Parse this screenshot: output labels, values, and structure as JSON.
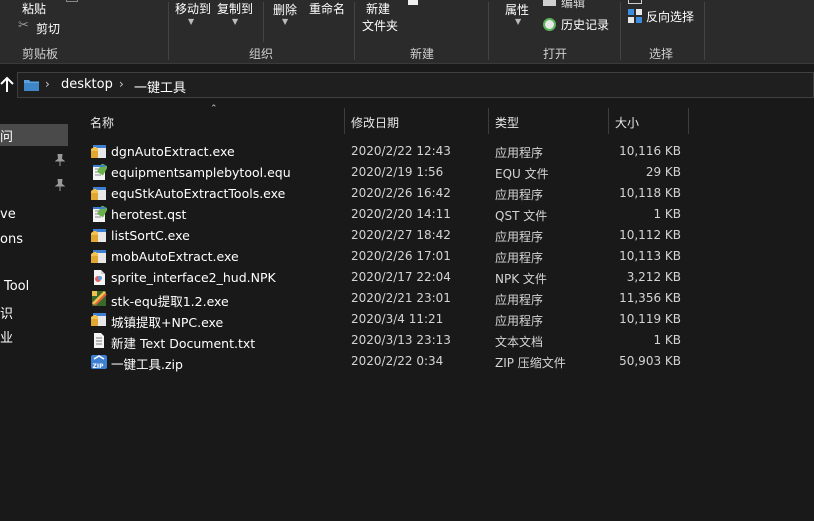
{
  "ribbon": {
    "paste": "粘贴",
    "cut": "剪切",
    "clipboard_group": "剪贴板",
    "move_to": "移动到",
    "copy_to": "复制到",
    "delete": "删除",
    "rename": "重命名",
    "organize_group": "组织",
    "new_folder_line1": "新建",
    "new_folder_line2": "文件夹",
    "new_group": "新建",
    "properties": "属性",
    "edit": "编辑",
    "history": "历史记录",
    "open_group": "打开",
    "invert_select": "反向选择",
    "select_group": "选择"
  },
  "address": {
    "segments": [
      "desktop",
      "一键工具"
    ]
  },
  "nav": {
    "items": [
      "问",
      "ve",
      "ons",
      "Tool",
      "识",
      "业"
    ]
  },
  "columns": {
    "name": "名称",
    "modified": "修改日期",
    "type": "类型",
    "size": "大小"
  },
  "files": [
    {
      "name": "dgnAutoExtract.exe",
      "modified": "2020/2/22 12:43",
      "type": "应用程序",
      "size": "10,116 KB",
      "icon": "exe-icon"
    },
    {
      "name": "equipmentsamplebytool.equ",
      "modified": "2020/2/19 1:56",
      "type": "EQU 文件",
      "size": "29 KB",
      "icon": "notepad-file-icon"
    },
    {
      "name": "equStkAutoExtractTools.exe",
      "modified": "2020/2/26 16:42",
      "type": "应用程序",
      "size": "10,118 KB",
      "icon": "exe-icon"
    },
    {
      "name": "herotest.qst",
      "modified": "2020/2/20 14:11",
      "type": "QST 文件",
      "size": "1 KB",
      "icon": "notepad-file-icon"
    },
    {
      "name": "listSortC.exe",
      "modified": "2020/2/27 18:42",
      "type": "应用程序",
      "size": "10,112 KB",
      "icon": "exe-icon"
    },
    {
      "name": "mobAutoExtract.exe",
      "modified": "2020/2/26 17:01",
      "type": "应用程序",
      "size": "10,113 KB",
      "icon": "exe-icon"
    },
    {
      "name": "sprite_interface2_hud.NPK",
      "modified": "2020/2/17 22:04",
      "type": "NPK 文件",
      "size": "3,212 KB",
      "icon": "npk-file-icon"
    },
    {
      "name": "stk-equ提取1.2.exe",
      "modified": "2020/2/21 23:01",
      "type": "应用程序",
      "size": "11,356 KB",
      "icon": "colored-exe-icon"
    },
    {
      "name": "城镇提取+NPC.exe",
      "modified": "2020/3/4 11:21",
      "type": "应用程序",
      "size": "10,119 KB",
      "icon": "exe-icon"
    },
    {
      "name": "新建 Text Document.txt",
      "modified": "2020/3/13 23:13",
      "type": "文本文档",
      "size": "1 KB",
      "icon": "text-file-icon"
    },
    {
      "name": "一键工具.zip",
      "modified": "2020/2/22 0:34",
      "type": "ZIP 压缩文件",
      "size": "50,903 KB",
      "icon": "zip-file-icon"
    }
  ]
}
